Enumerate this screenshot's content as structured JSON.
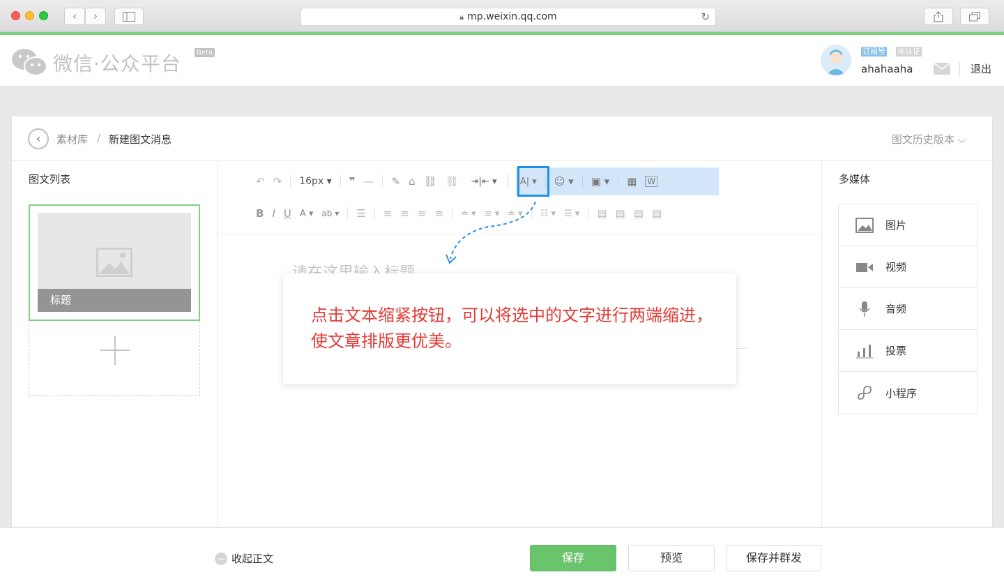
{
  "browser": {
    "url": "mp.weixin.qq.com",
    "back_glyph": "‹",
    "forward_glyph": "›",
    "reload_glyph": "↻"
  },
  "header": {
    "logo_text": "微信·公众平台",
    "beta": "Beta",
    "tag_type": "订阅号",
    "tag_verify": "未认证",
    "username": "ahahaaha",
    "logout": "退出"
  },
  "breadcrumb": {
    "parent": "素材库",
    "separator": "/",
    "current": "新建图文消息",
    "history": "图文历史版本 ⌵"
  },
  "left_panel": {
    "title": "图文列表",
    "card_title": "标题"
  },
  "toolbar": {
    "row1": [
      "↶",
      "↷",
      "16px ▾",
      "❞",
      "—",
      "✎",
      "⌂",
      "⛓",
      "⛓"
    ],
    "indent_btn": "⇥|⇤ ▾",
    "highlight_items": [
      "|A| ▾",
      "☺ ▾",
      "▣ ▾",
      "▦",
      "W"
    ],
    "row2": [
      "B",
      "I",
      "U",
      "A ▾",
      "ab ▾",
      "☰",
      "≡",
      "≡",
      "≡",
      "≡",
      "≐ ▾",
      "≡ ▾",
      "≐ ▾",
      "☷ ▾",
      "☰ ▾",
      "▤",
      "▤",
      "▤",
      "▤"
    ]
  },
  "editor": {
    "title_placeholder": "请在这里输入标题"
  },
  "right_panel": {
    "title": "多媒体",
    "items": [
      {
        "label": "图片",
        "icon": "image-icon"
      },
      {
        "label": "视频",
        "icon": "video-icon"
      },
      {
        "label": "音频",
        "icon": "microphone-icon"
      },
      {
        "label": "投票",
        "icon": "vote-icon"
      },
      {
        "label": "小程序",
        "icon": "mini-program-icon"
      }
    ]
  },
  "footer": {
    "collapse": "收起正文",
    "collapse_glyph": "−",
    "save": "保存",
    "preview": "预览",
    "save_send": "保存并群发"
  },
  "tooltip": {
    "text": "点击文本缩紧按钮，可以将选中的文字进行两端缩进，使文章排版更优美。",
    "color": "#e43a35"
  },
  "colors": {
    "accent_green": "#6ac46c",
    "highlight_blue": "#1e8fe9"
  }
}
